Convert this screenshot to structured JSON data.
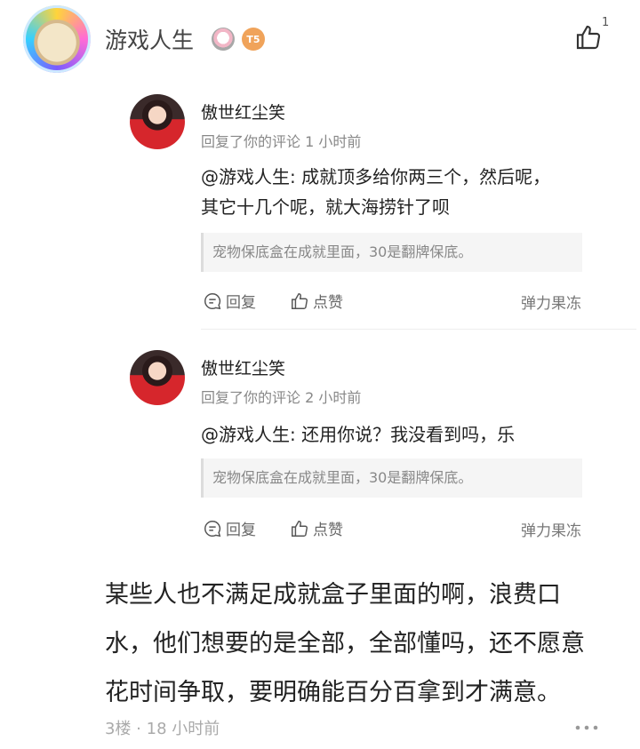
{
  "author": {
    "name": "游戏人生",
    "level_badge": "T5",
    "like_count": "1"
  },
  "replies": [
    {
      "name": "傲世红尘笑",
      "meta": "回复了你的评论 1 小时前",
      "text_line1": "@游戏人生: 成就顶多给你两三个，然后呢，",
      "text_line2": "其它十几个呢，就大海捞针了呗",
      "quote": "宠物保底盒在成就里面，30是翻牌保底。",
      "reply_label": "回复",
      "like_label": "点赞",
      "source": "弹力果冻"
    },
    {
      "name": "傲世红尘笑",
      "meta": "回复了你的评论 2 小时前",
      "text_line1": "@游戏人生: 还用你说？我没看到吗，乐",
      "quote": "宠物保底盒在成就里面，30是翻牌保底。",
      "reply_label": "回复",
      "like_label": "点赞",
      "source": "弹力果冻"
    }
  ],
  "main_comment": {
    "line1": "某些人也不满足成就盒子里面的啊，浪费口",
    "line2": "水，他们想要的是全部，全部懂吗，还不愿意",
    "line3": "花时间争取，要明确能百分百拿到才满意。"
  },
  "footer": {
    "meta": "3楼 · 18 小时前"
  }
}
